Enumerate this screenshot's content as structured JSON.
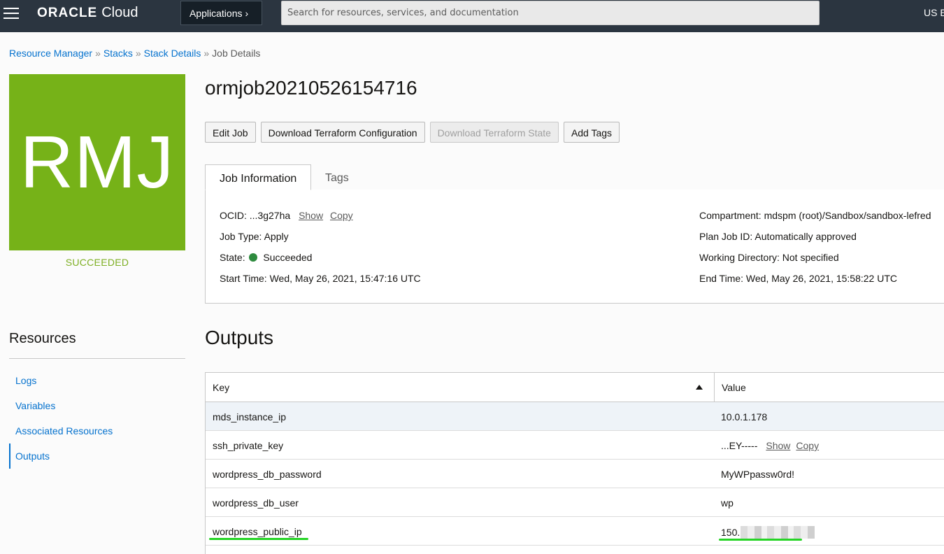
{
  "topbar": {
    "brand": "ORACLE",
    "product": "Cloud",
    "applications_label": "Applications",
    "search_placeholder": "Search for resources, services, and documentation",
    "region": "US E"
  },
  "breadcrumb": {
    "items": [
      "Resource Manager",
      "Stacks",
      "Stack Details"
    ],
    "current": "Job Details",
    "separator": "»"
  },
  "badge": {
    "initials": "RMJ",
    "status": "SUCCEEDED",
    "color": "#76b218"
  },
  "job": {
    "title": "ormjob20210526154716",
    "actions": [
      "Edit Job",
      "Download Terraform Configuration",
      "Download Terraform State",
      "Add Tags"
    ],
    "disabled_action": "Download Terraform State"
  },
  "tabs": [
    "Job Information",
    "Tags"
  ],
  "info": {
    "ocid_label": "OCID:",
    "ocid_value": "...3g27ha",
    "show": "Show",
    "copy": "Copy",
    "job_type_label": "Job Type:",
    "job_type_value": "Apply",
    "state_label": "State:",
    "state_value": "Succeeded",
    "start_label": "Start Time:",
    "start_value": "Wed, May 26, 2021, 15:47:16 UTC",
    "compartment_label": "Compartment:",
    "compartment_value": "mdspm (root)/Sandbox/sandbox-lefred",
    "plan_label": "Plan Job ID:",
    "plan_value": "Automatically approved",
    "workdir_label": "Working Directory:",
    "workdir_value": "Not specified",
    "end_label": "End Time:",
    "end_value": "Wed, May 26, 2021, 15:58:22 UTC"
  },
  "resources": {
    "title": "Resources",
    "items": [
      "Logs",
      "Variables",
      "Associated Resources",
      "Outputs"
    ],
    "active": "Outputs"
  },
  "outputs": {
    "title": "Outputs",
    "columns": [
      "Key",
      "Value"
    ],
    "rows": [
      {
        "key": "mds_instance_ip",
        "value": "10.0.1.178"
      },
      {
        "key": "ssh_private_key",
        "value": "...EY-----"
      },
      {
        "key": "wordpress_db_password",
        "value": "MyWPpassw0rd!"
      },
      {
        "key": "wordpress_db_user",
        "value": "wp"
      },
      {
        "key": "wordpress_public_ip",
        "value": "150."
      }
    ],
    "show": "Show",
    "copy": "Copy"
  },
  "colors": {
    "topbar": "#2b3540",
    "link": "#0572ce",
    "success_text": "#7eaf23",
    "state_dot": "#2e8b3e",
    "highlight_mark": "#25d425"
  }
}
